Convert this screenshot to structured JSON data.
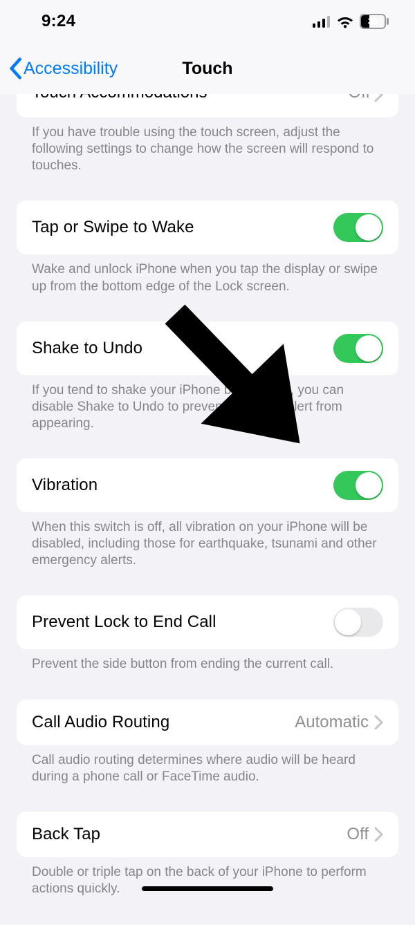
{
  "status_bar": {
    "time": "9:24",
    "battery_percent": "35"
  },
  "nav": {
    "back_label": "Accessibility",
    "title": "Touch"
  },
  "cutoff_row": {
    "title": "Touch Accommodations",
    "value": "Off"
  },
  "groups": [
    {
      "footer": "If you have trouble using the touch screen, adjust the following settings to change how the screen will respond to touches."
    },
    {
      "row": {
        "title": "Tap or Swipe to Wake",
        "type": "toggle",
        "on": true
      },
      "footer": "Wake and unlock iPhone when you tap the display or swipe up from the bottom edge of the Lock screen."
    },
    {
      "row": {
        "title": "Shake to Undo",
        "type": "toggle",
        "on": true
      },
      "footer": "If you tend to shake your iPhone by accident, you can disable Shake to Undo to prevent the Undo alert from appearing."
    },
    {
      "row": {
        "title": "Vibration",
        "type": "toggle",
        "on": true
      },
      "footer": "When this switch is off, all vibration on your iPhone will be disabled, including those for earthquake, tsunami and other emergency alerts."
    },
    {
      "row": {
        "title": "Prevent Lock to End Call",
        "type": "toggle",
        "on": false
      },
      "footer": "Prevent the side button from ending the current call."
    },
    {
      "row": {
        "title": "Call Audio Routing",
        "type": "link",
        "value": "Automatic"
      },
      "footer": "Call audio routing determines where audio will be heard during a phone call or FaceTime audio."
    },
    {
      "row": {
        "title": "Back Tap",
        "type": "link",
        "value": "Off"
      },
      "footer": "Double or triple tap on the back of your iPhone to perform actions quickly."
    }
  ]
}
